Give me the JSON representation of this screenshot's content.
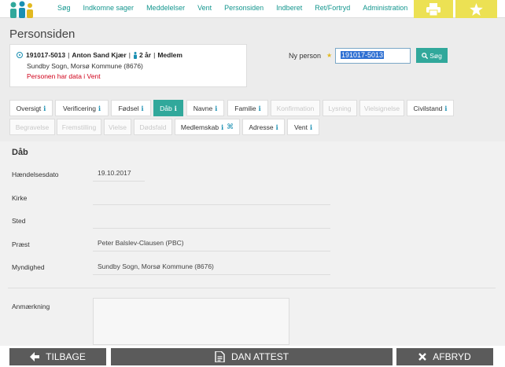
{
  "nav": {
    "items": [
      "Søg",
      "Indkomne sager",
      "Meddelelser",
      "Vent",
      "Personsiden",
      "Indberet",
      "Ret/Fortryd",
      "Administration"
    ]
  },
  "page_title": "Personsiden",
  "person": {
    "cpr": "191017-5013",
    "name": "Anton Sand Kjær",
    "age": "2 år",
    "status": "Medlem",
    "parish": "Sundby Sogn, Morsø Kommune (8676)",
    "warning": "Personen har data i Vent"
  },
  "ny_person": {
    "label": "Ny person",
    "value": "191017-5013",
    "search_label": "Søg"
  },
  "tabs_row1": [
    {
      "label": "Oversigt",
      "info": "i",
      "state": "normal"
    },
    {
      "label": "Verificering",
      "info": "i",
      "state": "normal"
    },
    {
      "label": "Fødsel",
      "info": "i",
      "state": "normal"
    },
    {
      "label": "Dåb",
      "info": "i",
      "state": "active"
    },
    {
      "label": "Navne",
      "info": "i",
      "state": "normal"
    },
    {
      "label": "Familie",
      "info": "i",
      "state": "normal"
    },
    {
      "label": "Konfirmation",
      "info": "",
      "state": "disabled"
    },
    {
      "label": "Lysning",
      "info": "",
      "state": "disabled"
    },
    {
      "label": "Vielsignelse",
      "info": "",
      "state": "disabled"
    },
    {
      "label": "Civilstand",
      "info": "i",
      "state": "normal"
    }
  ],
  "tabs_row2": [
    {
      "label": "Begravelse",
      "info": "",
      "state": "disabled"
    },
    {
      "label": "Fremstilling",
      "info": "",
      "state": "disabled"
    },
    {
      "label": "Vielse",
      "info": "",
      "state": "disabled"
    },
    {
      "label": "Dødsfald",
      "info": "",
      "state": "disabled"
    },
    {
      "label": "Medlemskab",
      "info": "i",
      "state": "normal"
    },
    {
      "label": "Adresse",
      "info": "i",
      "state": "normal"
    },
    {
      "label": "Vent",
      "info": "i",
      "state": "normal"
    }
  ],
  "section": {
    "title": "Dåb",
    "fields": [
      {
        "label": "Hændelsesdato",
        "value": "19.10.2017"
      },
      {
        "label": "Kirke",
        "value": ""
      },
      {
        "label": "Sted",
        "value": ""
      },
      {
        "label": "Præst",
        "value": "Peter Balslev-Clausen (PBC)"
      },
      {
        "label": "Myndighed",
        "value": "Sundby Sogn, Morsø Kommune (8676)"
      }
    ],
    "remark_label": "Anmærkning"
  },
  "bottom": {
    "back": "TILBAGE",
    "attest": "DAN ATTEST",
    "cancel": "AFBRYD"
  },
  "colors": {
    "accent": "#31a89b",
    "nav_text": "#13968e",
    "top_buttons": "#ece153",
    "warning": "#d0021b"
  }
}
